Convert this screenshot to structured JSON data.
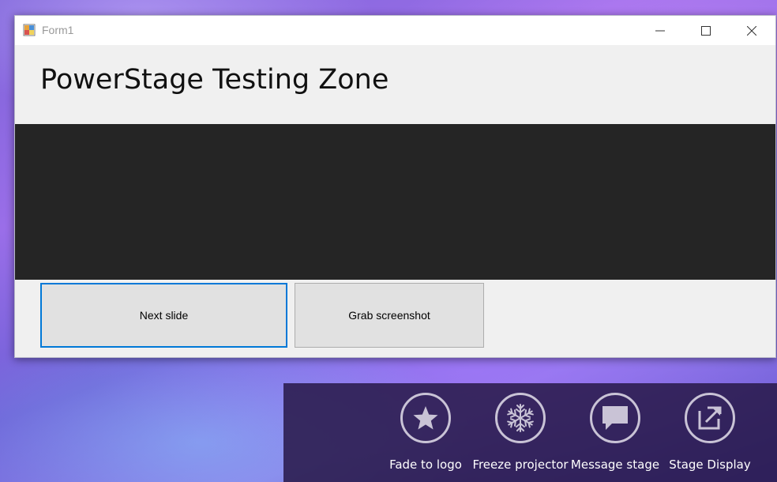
{
  "window": {
    "title": "Form1",
    "heading": "PowerStage Testing Zone",
    "buttons": {
      "next_slide": "Next slide",
      "grab_screenshot": "Grab screenshot"
    },
    "caption_icons": [
      "minimize-icon",
      "maximize-icon",
      "close-icon"
    ]
  },
  "toolbar": {
    "items": [
      {
        "label": "Fade to logo",
        "icon": "star-icon"
      },
      {
        "label": "Freeze projector",
        "icon": "snowflake-icon"
      },
      {
        "label": "Message stage",
        "icon": "speech-bubble-icon"
      },
      {
        "label": "Stage Display",
        "icon": "external-display-icon"
      }
    ]
  },
  "colors": {
    "accent": "#0078d7",
    "preview_bg": "#252525",
    "overlay_bg": "#281848"
  }
}
